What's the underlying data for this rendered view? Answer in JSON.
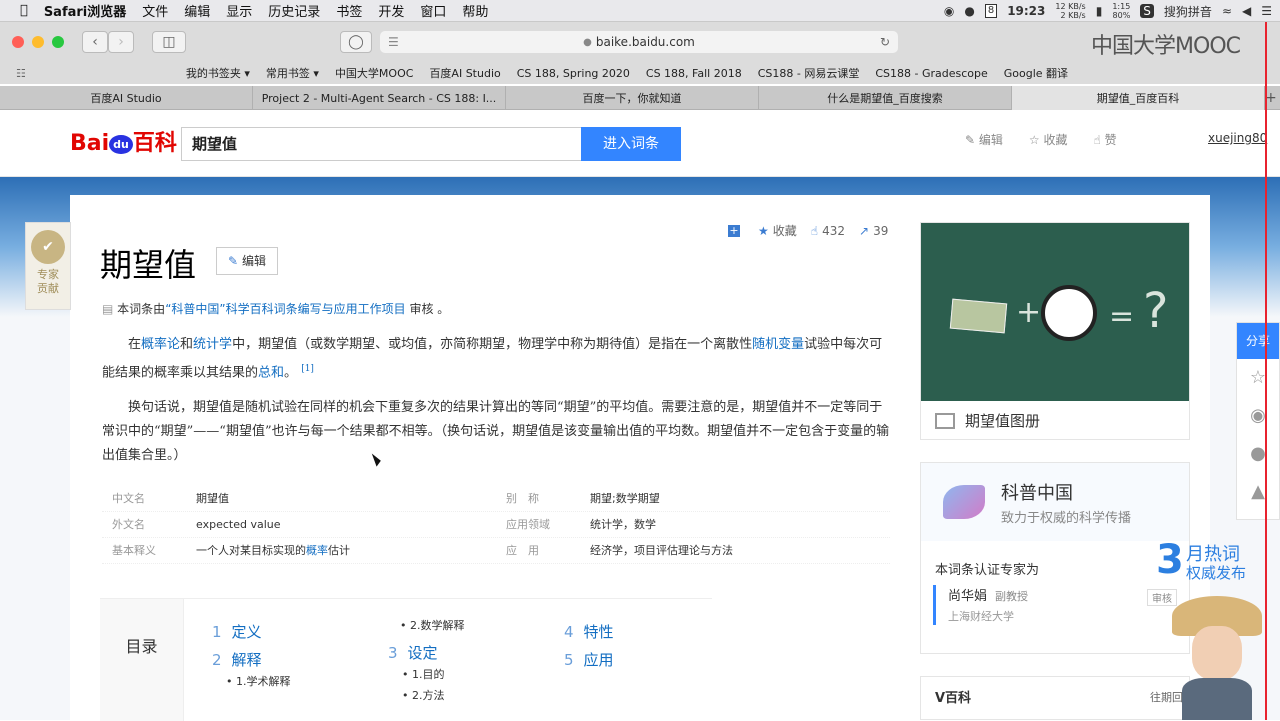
{
  "menubar": {
    "app": "Safari浏览器",
    "items": [
      "文件",
      "编辑",
      "显示",
      "历史记录",
      "书签",
      "开发",
      "窗口",
      "帮助"
    ],
    "calendar_badge": "8",
    "clock": "19:23",
    "net_up": "12 KB/s",
    "net_down": "2 KB/s",
    "battery_time": "1:15",
    "battery_pct": "80%",
    "ime": "搜狗拼音"
  },
  "toolbar": {
    "url": "baike.baidu.com",
    "mooc_logo": "中国大学MOOC"
  },
  "bookmarks": [
    "我的书签夹 ▾",
    "常用书签 ▾",
    "中国大学MOOC",
    "百度AI Studio",
    "CS 188, Spring 2020",
    "CS 188, Fall 2018",
    "CS188 - 网易云课堂",
    "CS188 - Gradescope",
    "Google 翻译"
  ],
  "tabs": [
    {
      "label": "百度AI Studio",
      "active": false
    },
    {
      "label": "Project 2 - Multi-Agent Search - CS 188: I...",
      "active": false
    },
    {
      "label": "百度一下，你就知道",
      "active": false
    },
    {
      "label": "什么是期望值_百度搜索",
      "active": false
    },
    {
      "label": "期望值_百度百科",
      "active": true
    }
  ],
  "header": {
    "logo_a": "Bai",
    "logo_du": "du",
    "logo_b": "百科",
    "search_value": "期望值",
    "enter_button": "进入词条",
    "action_edit": "编辑",
    "action_collect": "收藏",
    "action_like": "赞",
    "username": "xuejing80"
  },
  "entry": {
    "expert_badge": "专家贡献",
    "title": "期望值",
    "edit_button": "编辑",
    "collect": "收藏",
    "likes": "432",
    "shares": "39",
    "review_prefix": "本词条由",
    "review_link": "“科普中国”科学百科词条编写与应用工作项目",
    "review_suffix": " 审核 。",
    "p1_a": "在",
    "p1_link1": "概率论",
    "p1_b": "和",
    "p1_link2": "统计学",
    "p1_c": "中，期望值（或数学期望、或均值，亦简称期望，物理学中称为期待值）是指在一个离散性",
    "p1_link3": "随机变量",
    "p1_d": "试验中每次可能结果的概率乘以其结果的",
    "p1_link4": "总和",
    "p1_e": "。",
    "p1_ref": "[1]",
    "p2": "换句话说，期望值是随机试验在同样的机会下重复多次的结果计算出的等同“期望”的平均值。需要注意的是，期望值并不一定等同于常识中的“期望”——“期望值”也许与每一个结果都不相等。（换句话说，期望值是该变量输出值的平均数。期望值并不一定包含于变量的输出值集合里。）"
  },
  "basic_info": [
    {
      "l1": "中文名",
      "v1": "期望值",
      "l2": "别　称",
      "v2": "期望;数学期望"
    },
    {
      "l1": "外文名",
      "v1": "expected value",
      "l2": "应用领域",
      "v2": "统计学，数学"
    },
    {
      "l1": "基本释义",
      "v1a": "一个人对某目标实现的",
      "v1link": "概率",
      "v1b": "估计",
      "l2": "应　用",
      "v2": "经济学，项目评估理论与方法"
    }
  ],
  "toc": {
    "label": "目录",
    "l1": [
      {
        "num": "1",
        "text": "定义"
      },
      {
        "num": "2",
        "text": "解释"
      },
      {
        "num": "3",
        "text": "设定"
      },
      {
        "num": "4",
        "text": "特性"
      },
      {
        "num": "5",
        "text": "应用"
      }
    ],
    "l2": [
      "1.学术解释",
      "2.数学解释",
      "1.目的",
      "2.方法"
    ]
  },
  "sidebar": {
    "album_label": "期望值图册",
    "kepu_title": "科普中国",
    "kepu_sub": "致力于权威的科学传播",
    "cert_label": "本词条认证专家为",
    "expert_name": "尚华娟",
    "expert_title": "副教授",
    "expert_org": "上海财经大学",
    "expert_audit": "审核",
    "vbaike": "V百科",
    "vbaike_more": "往期回"
  },
  "share": {
    "label": "分享"
  },
  "hot": {
    "num": "3",
    "a": "月热词",
    "b": "权威发布"
  }
}
